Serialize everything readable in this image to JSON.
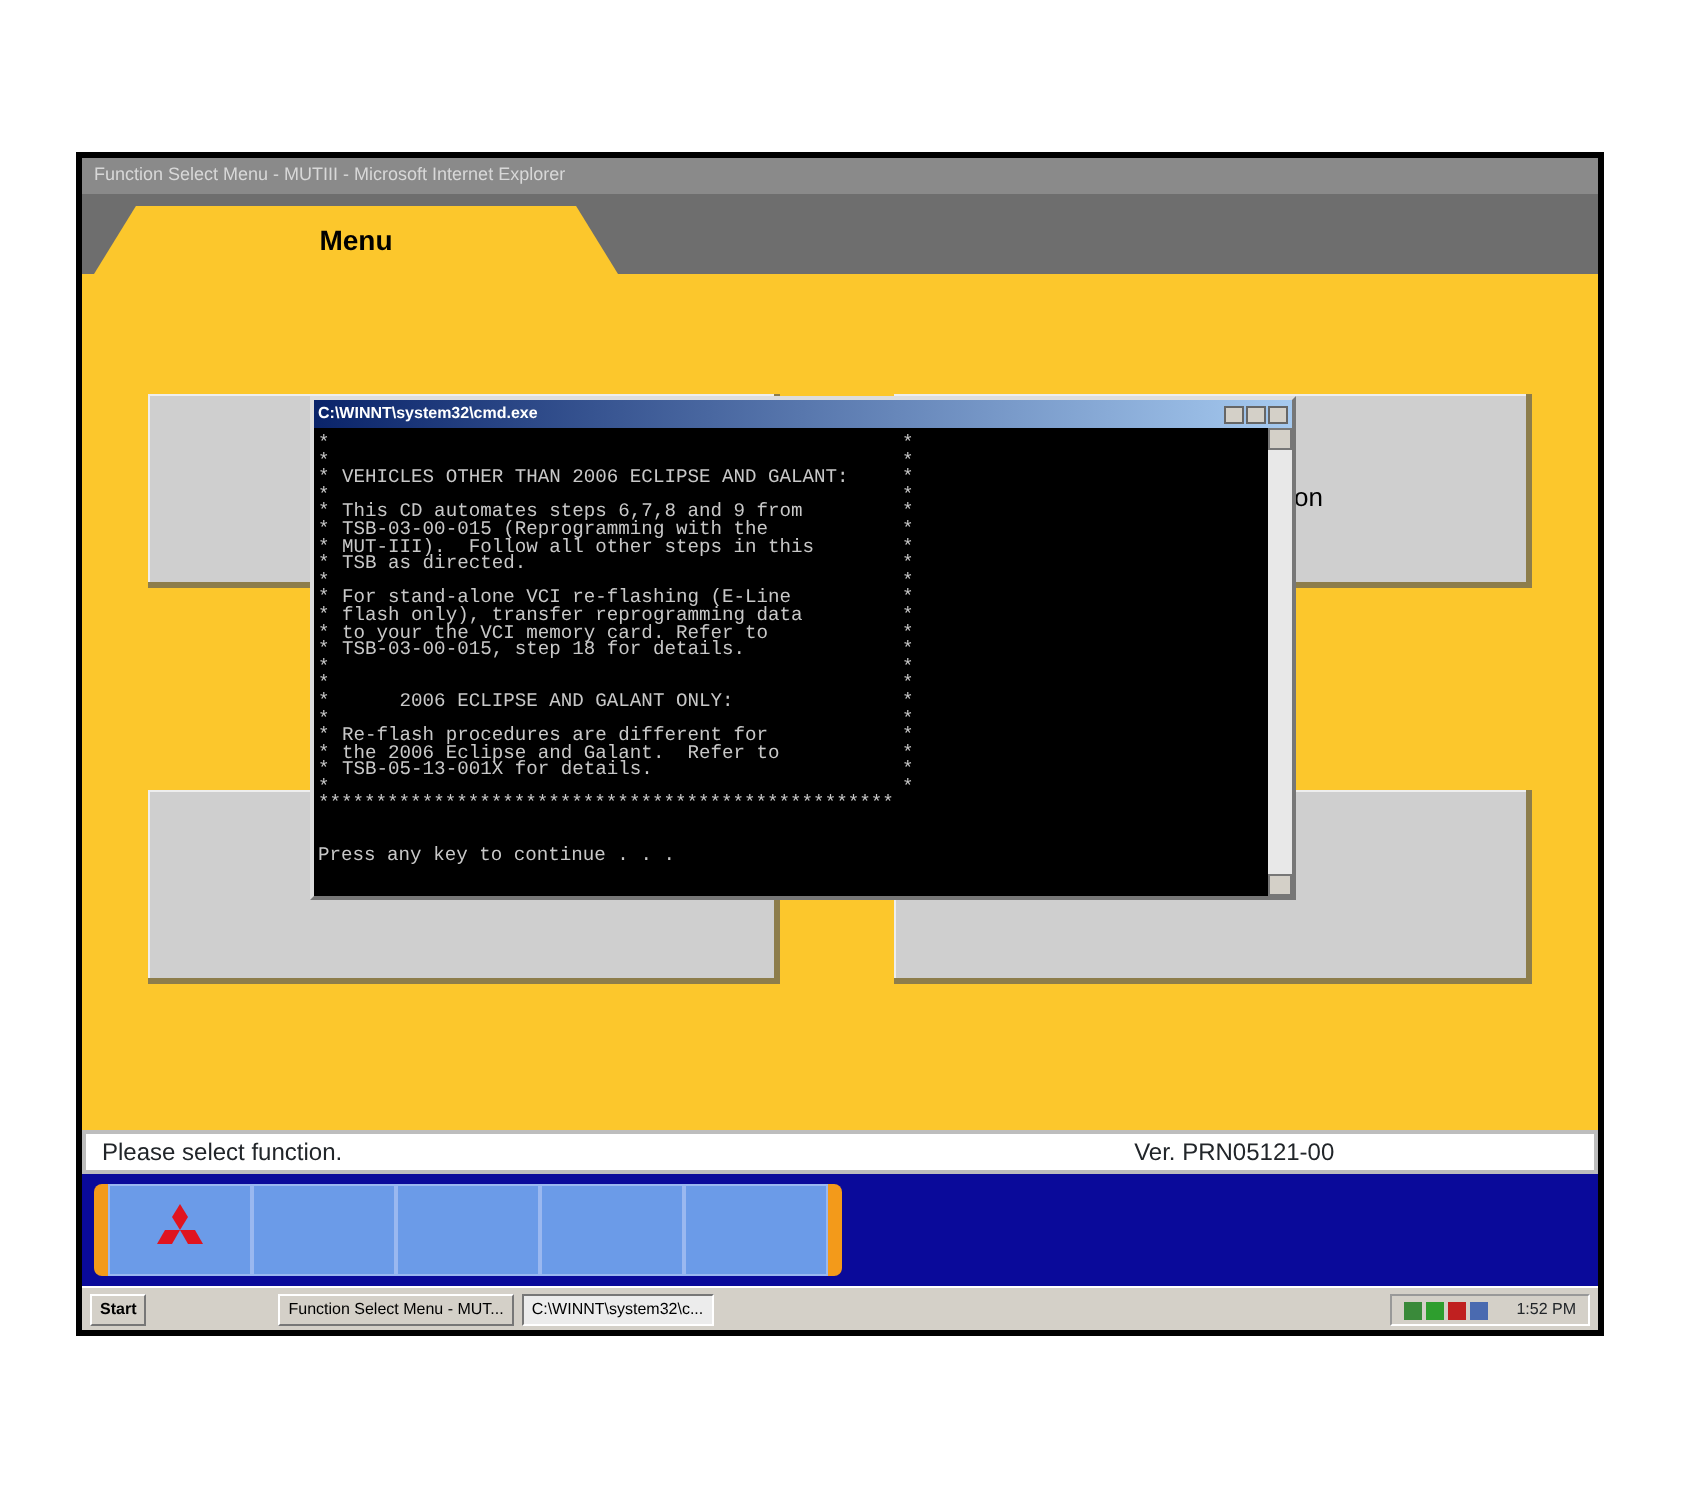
{
  "window": {
    "title": "Function Select Menu - MUTIII - Microsoft Internet Explorer"
  },
  "tab": {
    "label": "Menu",
    "selected": true
  },
  "menu_buttons": [
    {
      "kind": "covered"
    },
    {
      "kind": "labeled",
      "label": "on"
    },
    {
      "kind": "covered"
    },
    {
      "kind": "covered"
    }
  ],
  "console": {
    "title": "C:\\WINNT\\system32\\cmd.exe",
    "lines": [
      {
        "kind": "framed",
        "left": "*",
        "right": "*"
      },
      {
        "kind": "framed",
        "left": "*",
        "right": "*"
      },
      {
        "kind": "framed",
        "left": "*",
        "text": "VEHICLES OTHER THAN 2006 ECLIPSE AND GALANT:",
        "right": "*"
      },
      {
        "kind": "framed",
        "left": "*",
        "right": "*"
      },
      {
        "kind": "framed",
        "left": "*",
        "text": "This CD automates steps 6,7,8 and 9 from",
        "right": "*"
      },
      {
        "kind": "framed",
        "left": "*",
        "text": "TSB-03-00-015 (Reprogramming with the",
        "right": "*"
      },
      {
        "kind": "framed",
        "left": "*",
        "text": "MUT-III).  Follow all other steps in this",
        "right": "*"
      },
      {
        "kind": "framed",
        "left": "*",
        "text": "TSB as directed.",
        "right": "*"
      },
      {
        "kind": "framed",
        "left": "*",
        "right": "*"
      },
      {
        "kind": "framed",
        "left": "*",
        "text": "For stand-alone VCI re-flashing (E-Line",
        "right": "*"
      },
      {
        "kind": "framed",
        "left": "*",
        "text": "flash only), transfer reprogramming data",
        "right": "*"
      },
      {
        "kind": "framed",
        "left": "*",
        "text": "to your the VCI memory card. Refer to",
        "right": "*"
      },
      {
        "kind": "framed",
        "left": "*",
        "text": "TSB-03-00-015, step 18 for details.",
        "right": "*"
      },
      {
        "kind": "framed",
        "left": "*",
        "right": "*"
      },
      {
        "kind": "framed",
        "left": "*",
        "right": "*"
      },
      {
        "kind": "framed",
        "left": "*",
        "text": "     2006 ECLIPSE AND GALANT ONLY:",
        "right": "*"
      },
      {
        "kind": "framed",
        "left": "*",
        "right": "*"
      },
      {
        "kind": "framed",
        "left": "*",
        "text": "Re-flash procedures are different for",
        "right": "*"
      },
      {
        "kind": "framed",
        "left": "*",
        "text": "the 2006 Eclipse and Galant.  Refer to",
        "right": "*"
      },
      {
        "kind": "framed",
        "left": "*",
        "text": "TSB-05-13-001X for details.",
        "right": "*"
      },
      {
        "kind": "framed",
        "left": "*",
        "right": "*"
      },
      {
        "kind": "plain",
        "text": "**************************************************"
      },
      {
        "kind": "blank"
      },
      {
        "kind": "blank"
      },
      {
        "kind": "plain",
        "text": "Press any key to continue . . ."
      }
    ]
  },
  "status_bar": {
    "message": "Please select function.",
    "version": "Ver. PRN05121-00"
  },
  "toolbar": {
    "cells": [
      {
        "kind": "logo"
      },
      {
        "kind": "empty"
      },
      {
        "kind": "empty"
      },
      {
        "kind": "empty"
      },
      {
        "kind": "empty"
      }
    ]
  },
  "taskbar": {
    "start": "Start",
    "tasks": [
      {
        "label": "Function Select Menu - MUT...",
        "selected": false
      },
      {
        "label": "C:\\WINNT\\system32\\c...",
        "selected": true
      }
    ],
    "clock": "1:52 PM"
  }
}
